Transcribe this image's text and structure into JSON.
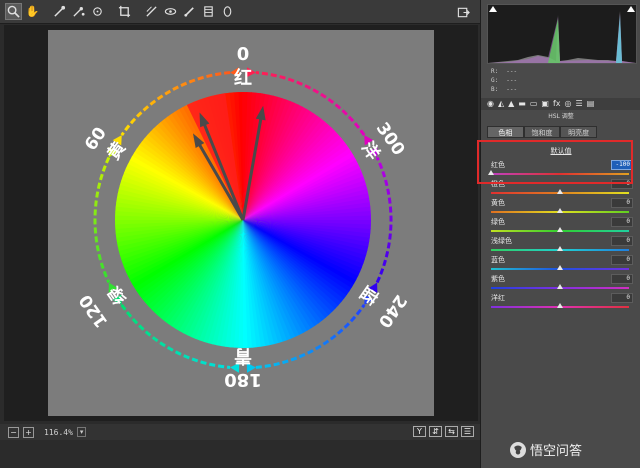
{
  "toolbar": {
    "tools": [
      "zoom-tool",
      "hand-tool",
      "white-balance-tool",
      "color-sampler-tool",
      "targeted-adjustment-tool",
      "crop-tool",
      "straighten-tool",
      "spot-removal-tool",
      "red-eye-tool",
      "adjustment-brush",
      "graduated-filter",
      "radial-filter"
    ]
  },
  "wheel": {
    "angle_0": "0",
    "angle_60": "60",
    "angle_120": "120",
    "angle_180": "180",
    "angle_240": "240",
    "angle_300": "300",
    "hue_red": "红",
    "hue_yellow": "黄",
    "hue_green": "绿",
    "hue_cyan": "青",
    "hue_blue": "蓝",
    "hue_magenta": "洋"
  },
  "bottom": {
    "zoom": "116.4%",
    "btn_minus": "−",
    "btn_plus": "+",
    "btn_y": "Y"
  },
  "panel": {
    "rgb": {
      "r": "R:",
      "g": "G:",
      "b": "B:",
      "dash": "---"
    },
    "title": "HSL 调整",
    "subtabs": [
      "色相",
      "饱和度",
      "明亮度"
    ],
    "default_link": "默认值",
    "rows": [
      {
        "label": "红色",
        "value": "-100",
        "level": -1.0
      },
      {
        "label": "橙色",
        "value": "0",
        "level": 0
      },
      {
        "label": "黄色",
        "value": "0",
        "level": 0
      },
      {
        "label": "绿色",
        "value": "0",
        "level": 0
      },
      {
        "label": "浅绿色",
        "value": "0",
        "level": 0
      },
      {
        "label": "蓝色",
        "value": "0",
        "level": 0
      },
      {
        "label": "紫色",
        "value": "0",
        "level": 0
      },
      {
        "label": "洋红",
        "value": "0",
        "level": 0
      }
    ]
  },
  "watermark": {
    "text": "悟空问答"
  },
  "colors": {
    "highlight": "#e02a2a",
    "selected_value": "#1f5fb8"
  }
}
